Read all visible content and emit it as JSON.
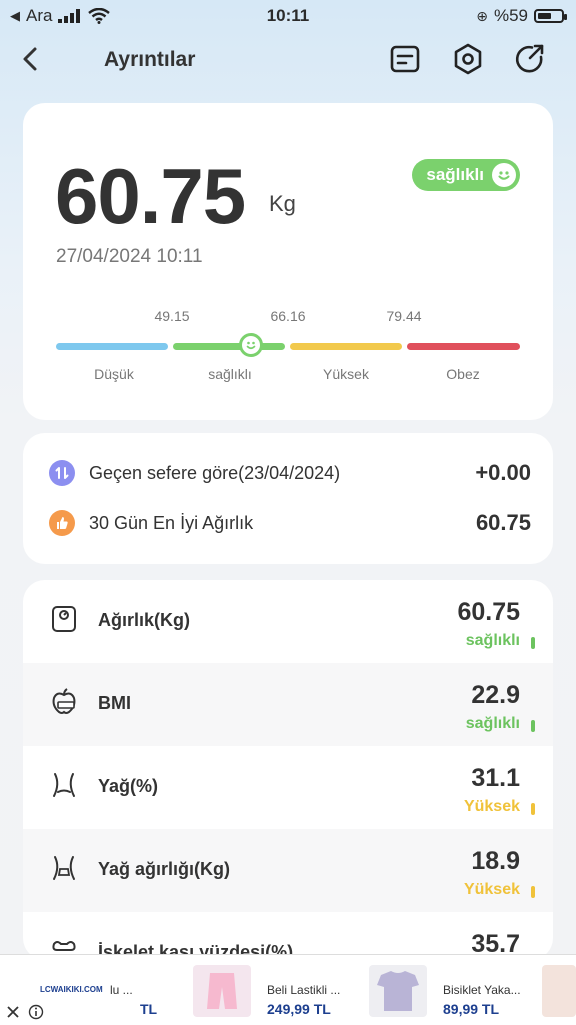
{
  "status_bar": {
    "carrier": "Ara",
    "time": "10:11",
    "battery": "%59",
    "battery_level": 0.59
  },
  "header": {
    "title": "Ayrıntılar"
  },
  "main": {
    "weight": "60.75",
    "unit": "Kg",
    "status": "sağlıklı",
    "datetime": "27/04/2024 10:11",
    "thresholds": [
      "49.15",
      "66.16",
      "79.44"
    ],
    "categories": [
      "Düşük",
      "sağlıklı",
      "Yüksek",
      "Obez"
    ],
    "category_colors": [
      "#7ec8ee",
      "#7bd16d",
      "#f2c94c",
      "#e0505c"
    ]
  },
  "compare": [
    {
      "label": "Geçen sefere göre(23/04/2024)",
      "value": "+0.00"
    },
    {
      "label": "30 Gün En İyi Ağırlık",
      "value": "60.75"
    }
  ],
  "metrics": [
    {
      "label": "Ağırlık(Kg)",
      "value": "60.75",
      "status": "sağlıklı",
      "color": "#6cc35f",
      "icon": "scale-icon"
    },
    {
      "label": "BMI",
      "value": "22.9",
      "status": "sağlıklı",
      "color": "#6cc35f",
      "icon": "apple-tape-icon"
    },
    {
      "label": "Yağ(%)",
      "value": "31.1",
      "status": "Yüksek",
      "color": "#f0c23a",
      "icon": "waist-icon"
    },
    {
      "label": "Yağ ağırlığı(Kg)",
      "value": "18.9",
      "status": "Yüksek",
      "color": "#f0c23a",
      "icon": "waist-weight-icon"
    },
    {
      "label": "İskelet kası yüzdesi(%)",
      "value": "35.7",
      "status": "",
      "color": "#6cc35f",
      "icon": "muscle-icon"
    }
  ],
  "ad": {
    "logo": "LCWAIKIKI.COM",
    "items": [
      {
        "name": "lu ...",
        "price": "TL"
      },
      {
        "name": "Beli Lastikli ...",
        "price": "249,99 TL"
      },
      {
        "name": "Bisiklet Yaka...",
        "price": "89,99 TL"
      }
    ]
  }
}
